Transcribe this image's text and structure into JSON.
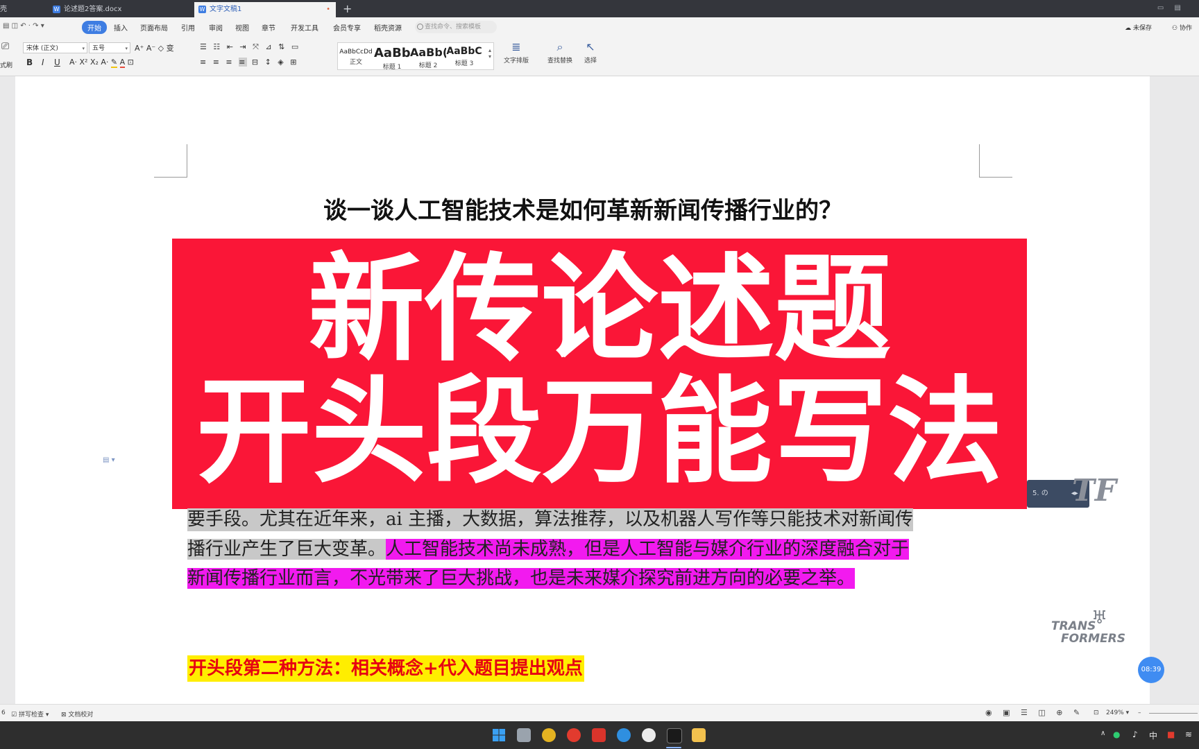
{
  "tabs": {
    "partial_label": "壳",
    "tab1_label": "论述题2答案.docx",
    "tab2_label": "文字文稿1",
    "new_tab_glyph": "+",
    "close_glyph": "•"
  },
  "menu": {
    "items": [
      "开始",
      "插入",
      "页面布局",
      "引用",
      "审阅",
      "视图",
      "章节",
      "开发工具",
      "会员专享",
      "稻壳资源"
    ],
    "search_placeholder": "查找命令、搜索模板",
    "unsaved": "未保存",
    "collab": "协作"
  },
  "ribbon": {
    "format_painter": "式刷",
    "font_name": "宋体 (正文)",
    "font_size": "五号",
    "styles": [
      {
        "preview": "AaBbCcDd",
        "name": "正文"
      },
      {
        "preview": "AaBb",
        "name": "标题 1"
      },
      {
        "preview": "AaBb(",
        "name": "标题 2"
      },
      {
        "preview": "AaBbC",
        "name": "标题 3"
      }
    ],
    "text_layout": "文字排版",
    "find_replace": "查找替换",
    "select": "选择"
  },
  "document": {
    "title": "谈一谈人工智能技术是如何革新新闻传播行业的？",
    "banner_line1": "新传论述题",
    "banner_line2": "开头段万能写法",
    "para_line1": "要手段。尤其在近年来，ai 主播，大数据，算法推荐，以及机器人写作等只能技术对新闻传",
    "para_line2_gray": "播行业产生了巨大变革。",
    "para_line2_pink": "人工智能技术尚未成熟，但是人工智能与媒介行业的深度融合对于",
    "para_line3_pink": "新闻传播行业而言，不光带来了巨大挑战，也是未来媒介探究前进方向的必要之举。",
    "method_line": "开头段第二种方法：相关概念+代入题目提出观点"
  },
  "overlay": {
    "panel_text": "5. の",
    "logo_text": "TF",
    "watermark_line1": "TRANS",
    "watermark_line2": "FORMERS",
    "timer": "08:39"
  },
  "statusbar": {
    "page_num": "6",
    "spell_check": "拼写检查",
    "doc_proof": "文档校对",
    "zoom": "249%"
  },
  "taskbar": {
    "ime": "中"
  },
  "colors": {
    "banner": "#fa1637",
    "highlight_pink": "#f21aef",
    "highlight_yellow": "#ffee00",
    "method_text": "#e60012",
    "accent_blue": "#3e7de2"
  }
}
